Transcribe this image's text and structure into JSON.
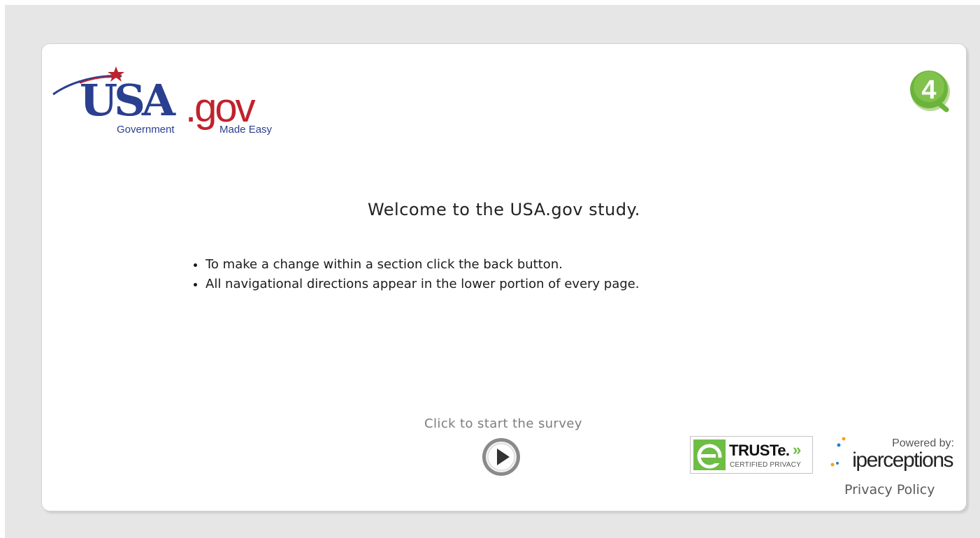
{
  "logo": {
    "main_text": "USA",
    "suffix_text": ".gov",
    "tagline_left": "Government",
    "tagline_right": "Made Easy"
  },
  "badge": {
    "label": "4",
    "icon": "4q-badge-icon",
    "color": "#6bb43b"
  },
  "welcome": {
    "heading": "Welcome to the USA.gov study."
  },
  "instructions": [
    "To make a change within a section click the back button.",
    "All navigational directions appear in the lower portion of every page."
  ],
  "start": {
    "label": "Click to start the survey",
    "icon": "play-icon"
  },
  "truste": {
    "name": "TRUSTe.",
    "arrows": "»",
    "subtitle": "CERTIFIED PRIVACY"
  },
  "powered": {
    "label": "Powered by:",
    "brand": "iperceptions"
  },
  "footer": {
    "privacy_link": "Privacy Policy"
  },
  "colors": {
    "usa_blue": "#2a3f8f",
    "gov_red": "#c0222d",
    "truste_green": "#6ebd45",
    "page_gray": "#e6e6e6"
  }
}
